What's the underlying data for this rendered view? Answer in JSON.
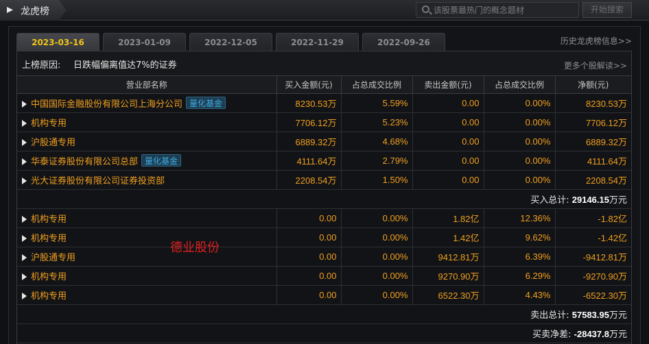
{
  "header": {
    "title": "龙虎榜",
    "search_placeholder": "该股票最热门的概念题材",
    "search_button": "开始搜索"
  },
  "tabs": [
    {
      "label": "2023-03-16",
      "active": true
    },
    {
      "label": "2023-01-09",
      "active": false
    },
    {
      "label": "2022-12-05",
      "active": false
    },
    {
      "label": "2022-11-29",
      "active": false
    },
    {
      "label": "2022-09-26",
      "active": false
    }
  ],
  "history_link": "历史龙虎榜信息>>",
  "reason": {
    "label": "上榜原因:",
    "text": "日跌幅偏离值达7%的证券",
    "more_link": "更多个股解读>>"
  },
  "table": {
    "headers": [
      "营业部名称",
      "买入金额(元)",
      "占总成交比例",
      "卖出金额(元)",
      "占总成交比例",
      "净额(元)"
    ],
    "buy_rows": [
      {
        "name": "中国国际金融股份有限公司上海分公司",
        "badge": "量化基金",
        "buy": "8230.53万",
        "buy_pct": "5.59%",
        "sell": "0.00",
        "sell_pct": "0.00%",
        "net": "8230.53万"
      },
      {
        "name": "机构专用",
        "badge": "",
        "buy": "7706.12万",
        "buy_pct": "5.23%",
        "sell": "0.00",
        "sell_pct": "0.00%",
        "net": "7706.12万"
      },
      {
        "name": "沪股通专用",
        "badge": "",
        "buy": "6889.32万",
        "buy_pct": "4.68%",
        "sell": "0.00",
        "sell_pct": "0.00%",
        "net": "6889.32万"
      },
      {
        "name": "华泰证券股份有限公司总部",
        "badge": "量化基金",
        "buy": "4111.64万",
        "buy_pct": "2.79%",
        "sell": "0.00",
        "sell_pct": "0.00%",
        "net": "4111.64万"
      },
      {
        "name": "光大证券股份有限公司证券投资部",
        "badge": "",
        "buy": "2208.54万",
        "buy_pct": "1.50%",
        "sell": "0.00",
        "sell_pct": "0.00%",
        "net": "2208.54万"
      }
    ],
    "buy_total": {
      "label": "买入总计:",
      "value": "29146.15",
      "unit": "万元"
    },
    "sell_rows": [
      {
        "name": "机构专用",
        "buy": "0.00",
        "buy_pct": "0.00%",
        "sell": "1.82亿",
        "sell_pct": "12.36%",
        "net": "-1.82亿"
      },
      {
        "name": "机构专用",
        "buy": "0.00",
        "buy_pct": "0.00%",
        "sell": "1.42亿",
        "sell_pct": "9.62%",
        "net": "-1.42亿"
      },
      {
        "name": "沪股通专用",
        "buy": "0.00",
        "buy_pct": "0.00%",
        "sell": "9412.81万",
        "sell_pct": "6.39%",
        "net": "-9412.81万"
      },
      {
        "name": "机构专用",
        "buy": "0.00",
        "buy_pct": "0.00%",
        "sell": "9270.90万",
        "sell_pct": "6.29%",
        "net": "-9270.90万"
      },
      {
        "name": "机构专用",
        "buy": "0.00",
        "buy_pct": "0.00%",
        "sell": "6522.30万",
        "sell_pct": "4.43%",
        "net": "-6522.30万"
      }
    ],
    "sell_total": {
      "label": "卖出总计:",
      "value": "57583.95",
      "unit": "万元"
    },
    "net_total": {
      "label": "买卖净差:",
      "value": "-28437.8",
      "unit": "万元"
    }
  },
  "watermark": "德业股份",
  "colors": {
    "accent": "#f0c419",
    "value": "#f0a020",
    "badge": "#3fa9e0",
    "watermark": "#e02020"
  }
}
